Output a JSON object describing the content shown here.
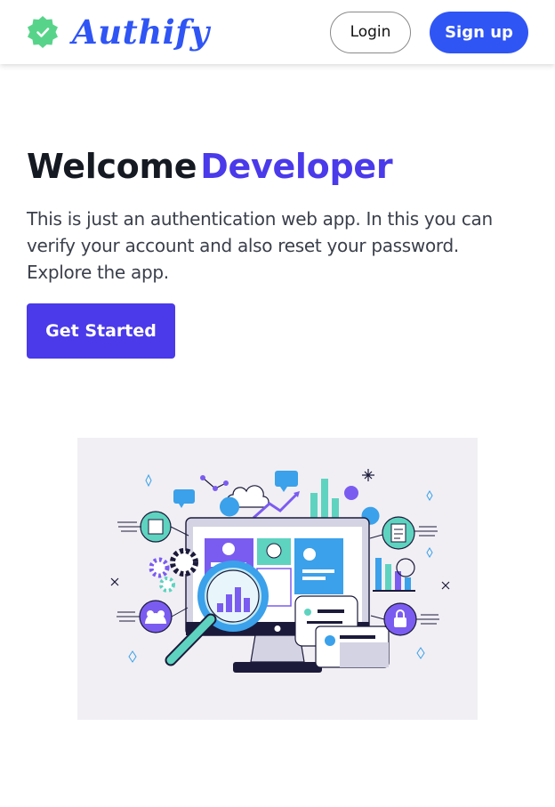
{
  "header": {
    "brand_name": "Authify",
    "login_label": "Login",
    "signup_label": "Sign up"
  },
  "hero": {
    "title_prefix": "Welcome",
    "title_highlight": "Developer",
    "description": "This is just an authentication web app. In this you can verify your account and also reset your password. Explore the app.",
    "cta_label": "Get Started"
  },
  "colors": {
    "brand_blue": "#2f55f5",
    "accent_purple": "#4a3aea",
    "logo_green": "#57d48a",
    "illustration_teal": "#5ed3c0",
    "illustration_purple": "#7b5cf0",
    "illustration_blue": "#3aa1ea"
  },
  "icons": {
    "logo": "verified-badge-icon",
    "illustration": "data-analytics-illustration"
  }
}
